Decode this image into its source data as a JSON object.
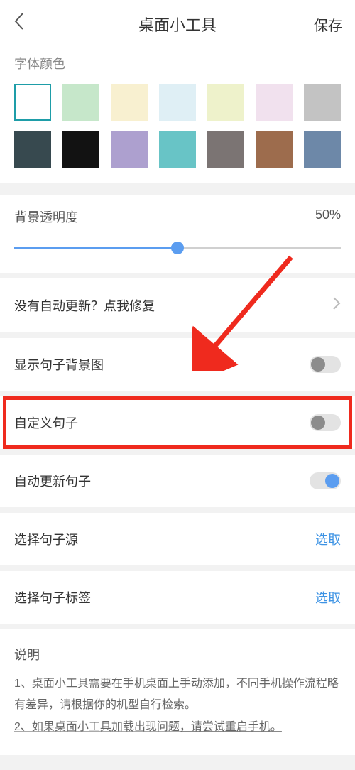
{
  "header": {
    "title": "桌面小工具",
    "save": "保存"
  },
  "font_color": {
    "label": "字体颜色",
    "swatches_row1": [
      "#ffffff",
      "#c6e7ca",
      "#f8f0d0",
      "#dfeff5",
      "#eef2cb",
      "#f1e1ee",
      "#c3c3c3"
    ],
    "swatches_row2": [
      "#37494f",
      "#121212",
      "#ada0cf",
      "#68c4c6",
      "#7b7473",
      "#9d6c4d",
      "#6d88a8"
    ],
    "selected_index": 0
  },
  "opacity": {
    "label": "背景透明度",
    "value_text": "50%",
    "percent": 50
  },
  "rows": {
    "repair": "没有自动更新？点我修复",
    "show_bg": "显示句子背景图",
    "custom": "自定义句子",
    "auto_update": "自动更新句子",
    "source": "选择句子源",
    "tags": "选择句子标签",
    "select_text": "选取"
  },
  "toggles": {
    "show_bg": false,
    "custom": false,
    "auto_update": true
  },
  "instructions": {
    "title": "说明",
    "line1": "1、桌面小工具需要在手机桌面上手动添加，不同手机操作流程略有差异，请根据你的机型自行检索。",
    "line2_a": "2、如果桌面小工具加载出现问题",
    "line2_b": "，请尝试重启手机。"
  }
}
